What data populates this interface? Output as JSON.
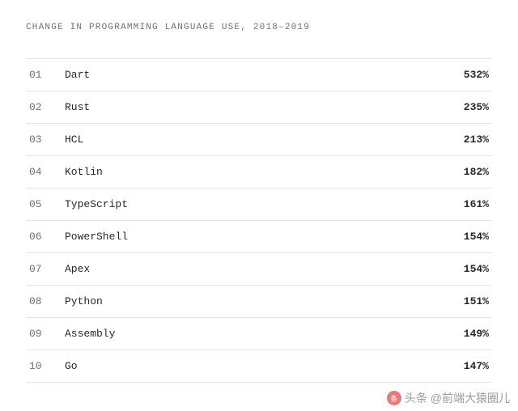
{
  "title": "CHANGE IN PROGRAMMING LANGUAGE USE, 2018–2019",
  "rows": [
    {
      "rank": "01",
      "name": "Dart",
      "pct": "532%"
    },
    {
      "rank": "02",
      "name": "Rust",
      "pct": "235%"
    },
    {
      "rank": "03",
      "name": "HCL",
      "pct": "213%"
    },
    {
      "rank": "04",
      "name": "Kotlin",
      "pct": "182%"
    },
    {
      "rank": "05",
      "name": "TypeScript",
      "pct": "161%"
    },
    {
      "rank": "06",
      "name": "PowerShell",
      "pct": "154%"
    },
    {
      "rank": "07",
      "name": "Apex",
      "pct": "154%"
    },
    {
      "rank": "08",
      "name": "Python",
      "pct": "151%"
    },
    {
      "rank": "09",
      "name": "Assembly",
      "pct": "149%"
    },
    {
      "rank": "10",
      "name": "Go",
      "pct": "147%"
    }
  ],
  "watermark": "头条 @前端大猿圈儿"
}
